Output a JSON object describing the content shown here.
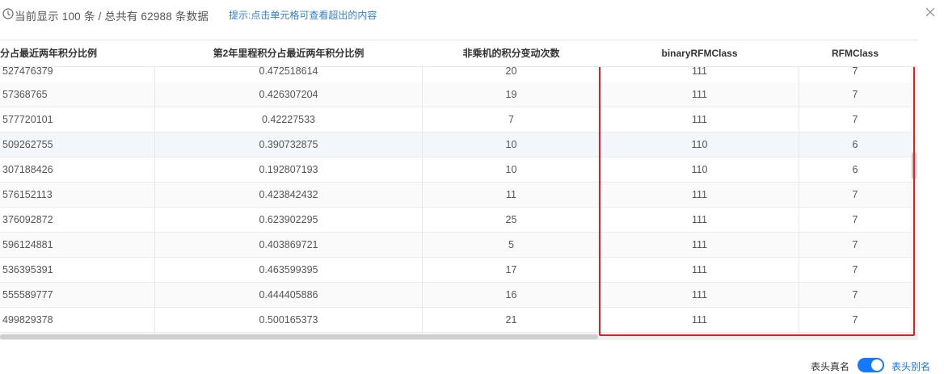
{
  "topbar": {
    "info_icon": "clock-info-icon",
    "info_text": "当前显示 100 条 / 总共有 62988 条数据",
    "hint": "提示:点击单元格可查看超出的内容",
    "close_icon": "close-icon"
  },
  "table": {
    "columns": [
      "分占最近两年积分比例",
      "第2年里程积分占最近两年积分比例",
      "非乘机的积分变动次数",
      "binaryRFMClass",
      "RFMClass"
    ],
    "rows": [
      [
        "527476379",
        "0.472518614",
        "20",
        "111",
        "7"
      ],
      [
        "57368765",
        "0.426307204",
        "19",
        "111",
        "7"
      ],
      [
        "577720101",
        "0.42227533",
        "7",
        "111",
        "7"
      ],
      [
        "509262755",
        "0.390732875",
        "10",
        "110",
        "6"
      ],
      [
        "307188426",
        "0.192807193",
        "10",
        "110",
        "6"
      ],
      [
        "576152113",
        "0.423842432",
        "11",
        "111",
        "7"
      ],
      [
        "376092872",
        "0.623902295",
        "25",
        "111",
        "7"
      ],
      [
        "596124881",
        "0.403869721",
        "5",
        "111",
        "7"
      ],
      [
        "536395391",
        "0.463599395",
        "17",
        "111",
        "7"
      ],
      [
        "555589777",
        "0.444405886",
        "16",
        "111",
        "7"
      ],
      [
        "499829378",
        "0.500165373",
        "21",
        "111",
        "7"
      ]
    ],
    "highlight_color": "#e02020"
  },
  "footer": {
    "real_name_label": "表头真名",
    "alias_label": "表头别名",
    "toggle_on": true,
    "accent": "#1677ff"
  }
}
